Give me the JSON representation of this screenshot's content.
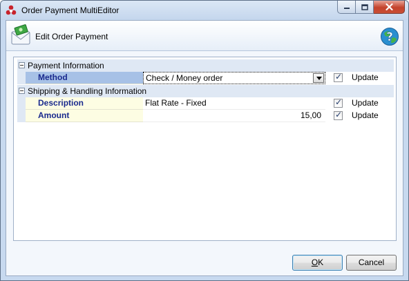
{
  "window": {
    "title": "Order Payment MultiEditor"
  },
  "header": {
    "title": "Edit Order Payment"
  },
  "grid": {
    "categories": [
      {
        "label": "Payment Information"
      },
      {
        "label": "Shipping & Handling Information"
      }
    ],
    "method": {
      "name": "Method",
      "value": "Check / Money order",
      "update_label": "Update"
    },
    "description": {
      "name": "Description",
      "value": "Flat Rate - Fixed",
      "update_label": "Update"
    },
    "amount": {
      "name": "Amount",
      "value": "15,00",
      "update_label": "Update"
    }
  },
  "buttons": {
    "ok_label": "OK",
    "cancel_label": "Cancel"
  },
  "icons": {
    "app": "app-logo-icon",
    "header": "payment-envelope-icon",
    "help": "help-globe-icon"
  },
  "colors": {
    "selected_row": "#a7c1e6",
    "property_name": "#1a2a8e",
    "property_cell": "#fdfde3"
  }
}
